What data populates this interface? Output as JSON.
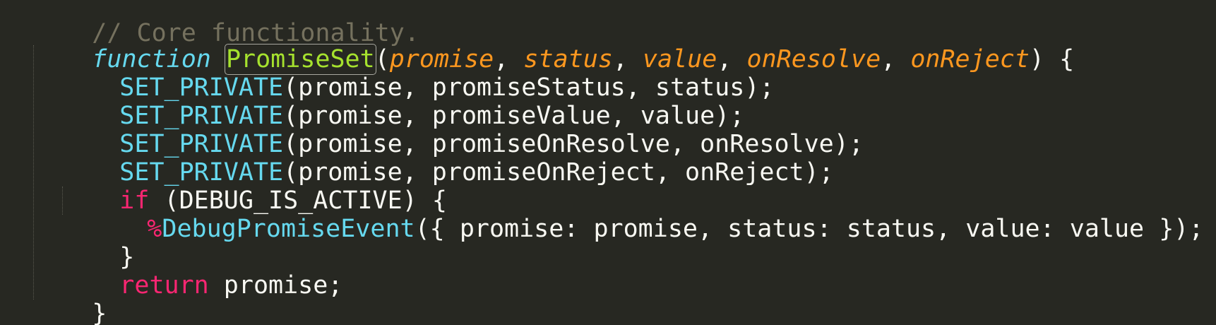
{
  "lines": [
    {
      "id": "comment",
      "tokens": [
        "// Core functionality."
      ]
    },
    {
      "id": "func-decl",
      "tokens": [
        "function",
        " ",
        "PromiseSet",
        "(",
        "promise",
        ", ",
        "status",
        ", ",
        "value",
        ", ",
        "onResolve",
        ", ",
        "onReject",
        ") {"
      ]
    },
    {
      "id": "set-status",
      "tokens": [
        "SET_PRIVATE",
        "(promise, promiseStatus, status);"
      ]
    },
    {
      "id": "set-value",
      "tokens": [
        "SET_PRIVATE",
        "(promise, promiseValue, value);"
      ]
    },
    {
      "id": "set-onresolve",
      "tokens": [
        "SET_PRIVATE",
        "(promise, promiseOnResolve, onResolve);"
      ]
    },
    {
      "id": "set-onreject",
      "tokens": [
        "SET_PRIVATE",
        "(promise, promiseOnReject, onReject);"
      ]
    },
    {
      "id": "if-debug",
      "tokens": [
        "if",
        " (DEBUG_IS_ACTIVE) {"
      ]
    },
    {
      "id": "debug-event",
      "tokens": [
        "%",
        "DebugPromiseEvent",
        "({ promise: promise, status: status, value: value });"
      ]
    },
    {
      "id": "if-close",
      "tokens": [
        "}"
      ]
    },
    {
      "id": "return",
      "tokens": [
        "return",
        " promise;"
      ]
    },
    {
      "id": "func-close",
      "tokens": [
        "}"
      ]
    }
  ]
}
